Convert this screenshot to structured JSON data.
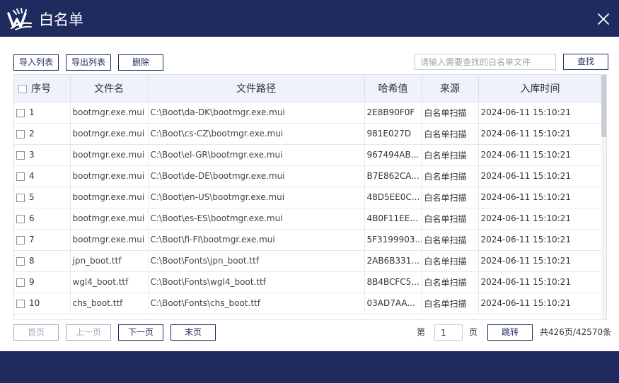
{
  "window": {
    "title": "白名单"
  },
  "toolbar": {
    "import_label": "导入列表",
    "export_label": "导出列表",
    "delete_label": "删除",
    "search_placeholder": "请输入需要查找的白名单文件",
    "search_value": "",
    "find_label": "查找"
  },
  "table": {
    "columns": [
      "序号",
      "文件名",
      "文件路径",
      "哈希值",
      "来源",
      "入库时间"
    ],
    "rows": [
      [
        "1",
        "bootmgr.exe.mui",
        "C:\\Boot\\da-DK\\bootmgr.exe.mui",
        "2E8B90F0F",
        "白名单扫描",
        "2024-06-11 15:10:21"
      ],
      [
        "2",
        "bootmgr.exe.mui",
        "C:\\Boot\\cs-CZ\\bootmgr.exe.mui",
        "981E027D",
        "白名单扫描",
        "2024-06-11 15:10:21"
      ],
      [
        "3",
        "bootmgr.exe.mui",
        "C:\\Boot\\el-GR\\bootmgr.exe.mui",
        "967494AB...",
        "白名单扫描",
        "2024-06-11 15:10:21"
      ],
      [
        "4",
        "bootmgr.exe.mui",
        "C:\\Boot\\de-DE\\bootmgr.exe.mui",
        "B7E862CA...",
        "白名单扫描",
        "2024-06-11 15:10:21"
      ],
      [
        "5",
        "bootmgr.exe.mui",
        "C:\\Boot\\en-US\\bootmgr.exe.mui",
        "48D5EE0C...",
        "白名单扫描",
        "2024-06-11 15:10:21"
      ],
      [
        "6",
        "bootmgr.exe.mui",
        "C:\\Boot\\es-ES\\bootmgr.exe.mui",
        "4B0F11EE...",
        "白名单扫描",
        "2024-06-11 15:10:21"
      ],
      [
        "7",
        "bootmgr.exe.mui",
        "C:\\Boot\\fi-FI\\bootmgr.exe.mui",
        "5F3199903...",
        "白名单扫描",
        "2024-06-11 15:10:21"
      ],
      [
        "8",
        "jpn_boot.ttf",
        "C:\\Boot\\Fonts\\jpn_boot.ttf",
        "2AB6B331...",
        "白名单扫描",
        "2024-06-11 15:10:21"
      ],
      [
        "9",
        "wgl4_boot.ttf",
        "C:\\Boot\\Fonts\\wgl4_boot.ttf",
        "8B4BCFC5...",
        "白名单扫描",
        "2024-06-11 15:10:21"
      ],
      [
        "10",
        "chs_boot.ttf",
        "C:\\Boot\\Fonts\\chs_boot.ttf",
        "03AD7AA...",
        "白名单扫描",
        "2024-06-11 15:10:21"
      ]
    ]
  },
  "pagination": {
    "first_label": "首页",
    "prev_label": "上一页",
    "next_label": "下一页",
    "last_label": "末页",
    "page_prefix": "第",
    "page_value": "1",
    "page_suffix": "页",
    "jump_label": "跳转",
    "summary": "共426页/42570条"
  },
  "colors": {
    "navy": "#1f2b5e",
    "header_bg": "#eef2fb",
    "disabled": "#a7acbe"
  },
  "icons": {
    "logo": "brand-logo-icon",
    "close": "close-icon",
    "checkbox": "checkbox-icon"
  }
}
